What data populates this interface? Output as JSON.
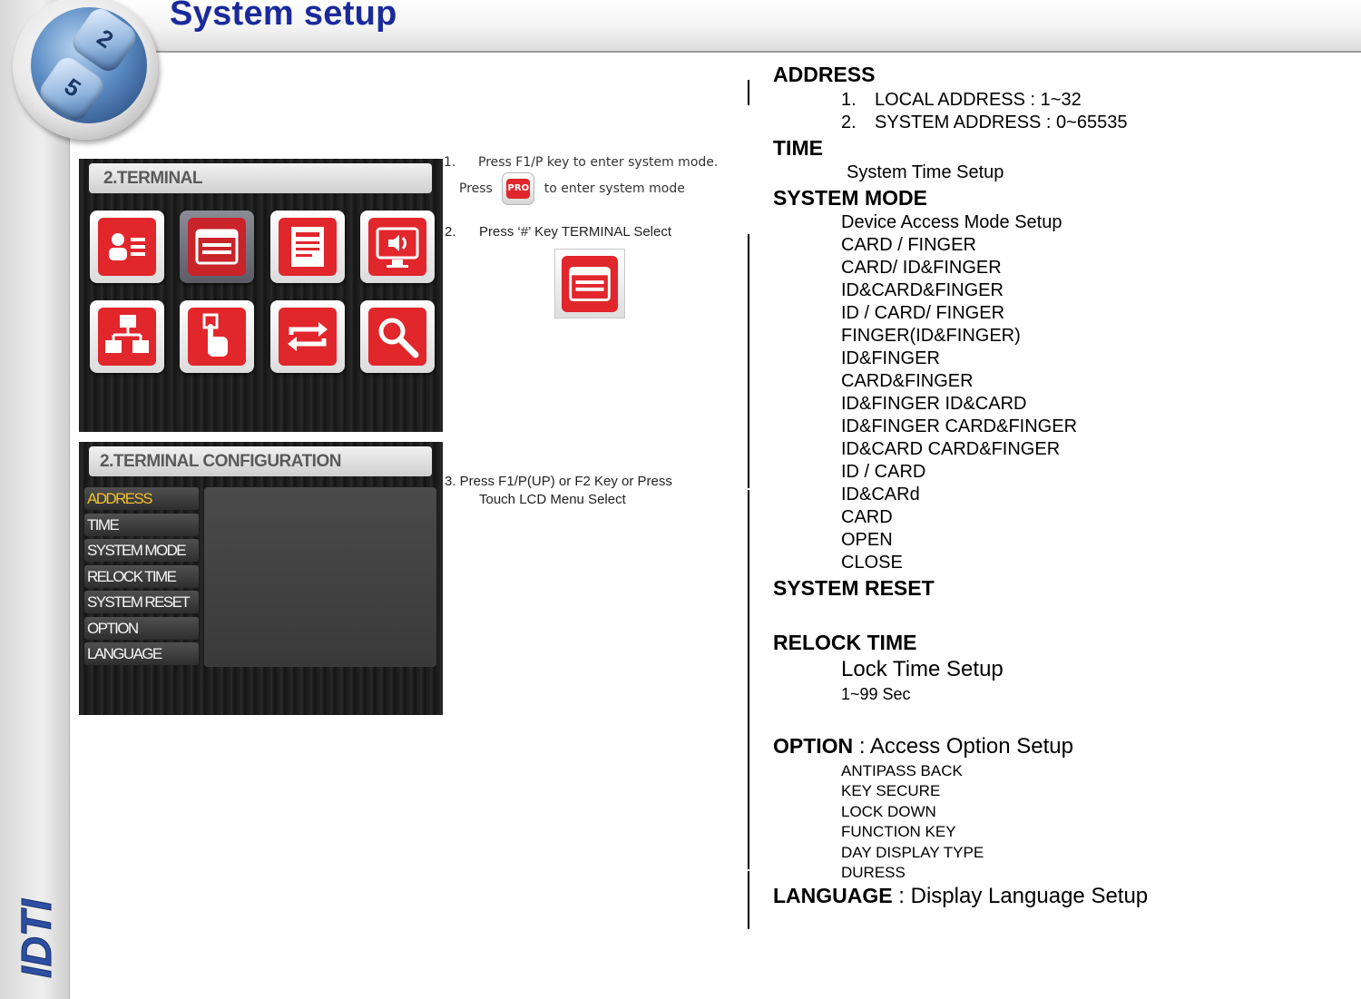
{
  "title": "System setup",
  "logo": {
    "keys": [
      "2ABC",
      "5JKL"
    ],
    "brand": "IDTI"
  },
  "screen1": {
    "title": "2.TERMINAL",
    "tiles": [
      "profile-icon",
      "terminal-icon",
      "document-icon",
      "speaker-monitor-icon",
      "network-icon",
      "touch-icon",
      "sync-icon",
      "search-icon"
    ],
    "selected_tile": "terminal-icon"
  },
  "screen2": {
    "title": "2.TERMINAL CONFIGURATION",
    "menu": [
      "ADDRESS",
      "TIME",
      "SYSTEM MODE",
      "RELOCK TIME",
      "SYSTEM RESET",
      "OPTION",
      "LANGUAGE"
    ]
  },
  "steps": {
    "s1_num": "1.",
    "s1_text": "Press F1/P key to enter system mode.",
    "s1b_pre": "Press",
    "s1b_post": "to enter system mode",
    "pro_label": "PRO",
    "s2_num": "2.",
    "s2_text": "Press ‘#’ Key TERMINAL Select",
    "s3_line1": "3. Press  F1/P(UP) or F2 Key or  Press",
    "s3_line2": "Touch LCD Menu Select"
  },
  "right": {
    "address_h": "ADDRESS",
    "address_items": [
      {
        "num": "1.",
        "text": "LOCAL ADDRESS : 1~32"
      },
      {
        "num": "2.",
        "text": "SYSTEM ADDRESS : 0~65535"
      }
    ],
    "time_h": "TIME",
    "time_desc": "System Time Setup",
    "mode_h": "SYSTEM MODE",
    "mode_items": [
      "Device Access Mode Setup",
      "CARD / FINGER",
      "CARD/ ID&FINGER",
      "ID&CARD&FINGER",
      "ID / CARD/ FINGER",
      "FINGER(ID&FINGER)",
      "ID&FINGER",
      "CARD&FINGER",
      "ID&FINGER  ID&CARD",
      "ID&FINGER CARD&FINGER",
      "ID&CARD CARD&FINGER",
      "ID / CARD",
      "ID&CARd",
      "CARD",
      "OPEN",
      "CLOSE"
    ],
    "reset_h": "SYSTEM RESET",
    "relock_h": "RELOCK TIME",
    "relock_desc": "Lock Time Setup",
    "relock_range": "1~99 Sec",
    "option_h": "OPTION",
    "option_desc": " : Access Option Setup",
    "option_items": [
      "ANTIPASS BACK",
      "KEY SECURE",
      "LOCK DOWN",
      "FUNCTION KEY",
      "DAY DISPLAY TYPE",
      "DURESS"
    ],
    "language_h": "LANGUAGE",
    "language_desc": " : Display Language Setup"
  }
}
